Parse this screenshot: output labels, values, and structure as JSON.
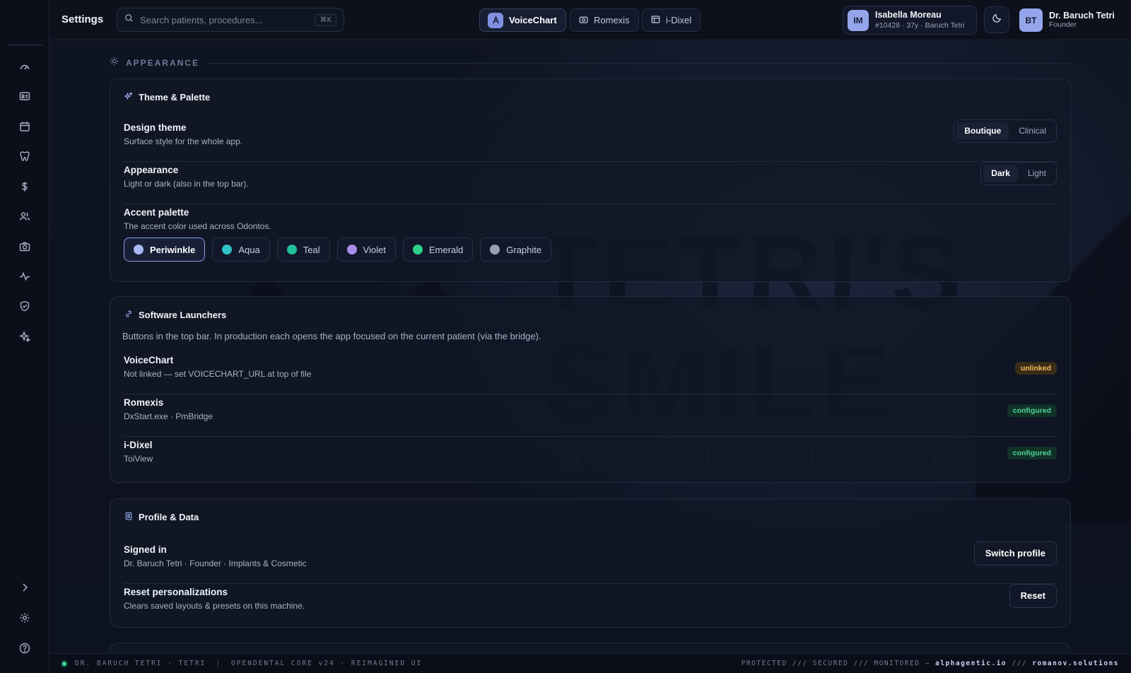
{
  "topbar": {
    "title": "Settings",
    "search_placeholder": "Search patients, procedures...",
    "search_shortcut": "⌘K",
    "launchers": [
      {
        "label": "VoiceChart",
        "icon": "voicechart-icon",
        "active": true
      },
      {
        "label": "Romexis",
        "icon": "camera-icon",
        "active": false
      },
      {
        "label": "i-Dixel",
        "icon": "image-viewer-icon",
        "active": false
      }
    ],
    "patient": {
      "initials": "IM",
      "name": "Isabella Moreau",
      "meta": "#10428 · 37y · Baruch Tetri"
    },
    "user": {
      "initials": "BT",
      "name": "Dr. Baruch Tetri",
      "role": "Founder"
    }
  },
  "sidebar": {
    "items": [
      "dashboard-icon",
      "patients-card-icon",
      "calendar-icon",
      "tooth-icon",
      "dollar-icon",
      "users-icon",
      "camera-icon",
      "activity-icon",
      "shield-icon",
      "sparkle-icon"
    ],
    "bottom": [
      "chevron-right-icon",
      "gear-icon",
      "help-icon"
    ]
  },
  "watermark": {
    "title": "TETRI'S",
    "subtitle": "SMILE",
    "tagline": "DENTAL BOUTIQUE"
  },
  "appearance": {
    "section_label": "APPEARANCE",
    "card_title": "Theme & Palette",
    "design_theme": {
      "label": "Design theme",
      "desc": "Surface style for the whole app.",
      "options": [
        "Boutique",
        "Clinical"
      ],
      "selected": "Boutique"
    },
    "mode": {
      "label": "Appearance",
      "desc": "Light or dark (also in the top bar).",
      "options": [
        "Dark",
        "Light"
      ],
      "selected": "Dark"
    },
    "accent": {
      "label": "Accent palette",
      "desc": "The accent color used across Odontos.",
      "selected": "Periwinkle",
      "options": [
        {
          "name": "Periwinkle",
          "color": "#a9b6f0"
        },
        {
          "name": "Aqua",
          "color": "#2fc3c7"
        },
        {
          "name": "Teal",
          "color": "#1fbf9a"
        },
        {
          "name": "Violet",
          "color": "#a98be8"
        },
        {
          "name": "Emerald",
          "color": "#2ecf8a"
        },
        {
          "name": "Graphite",
          "color": "#9aa1b2"
        }
      ]
    }
  },
  "launchers_card": {
    "title": "Software Launchers",
    "intro": "Buttons in the top bar. In production each opens the app focused on the current patient (via the bridge).",
    "items": [
      {
        "name": "VoiceChart",
        "desc": "Not linked — set VOICECHART_URL at top of file",
        "status": "unlinked"
      },
      {
        "name": "Romexis",
        "desc": "DxStart.exe · PmBridge",
        "status": "configured"
      },
      {
        "name": "i-Dixel",
        "desc": "ToiView",
        "status": "configured"
      }
    ]
  },
  "profile_card": {
    "title": "Profile & Data",
    "signed_in": {
      "label": "Signed in",
      "desc": "Dr. Baruch Tetri · Founder · Implants & Cosmetic",
      "button": "Switch profile"
    },
    "reset": {
      "label": "Reset personalizations",
      "desc": "Clears saved layouts & presets on this machine.",
      "button": "Reset"
    }
  },
  "footer": {
    "left": "DR. BARUCH TETRI · TETRI",
    "center": "OPENDENTAL CORE v24 · REIMAGINED UI",
    "right_prefix": "PROTECTED /// SECURED /// MONITORED — ",
    "right_link1": "alphagentic.io",
    "right_sep": " /// ",
    "right_link2": "romanov.solutions"
  },
  "colors": {
    "accent": "#a9b6f0",
    "ok": "#4ed49a",
    "warn": "#f3be5d",
    "bg": "#0e1320"
  }
}
